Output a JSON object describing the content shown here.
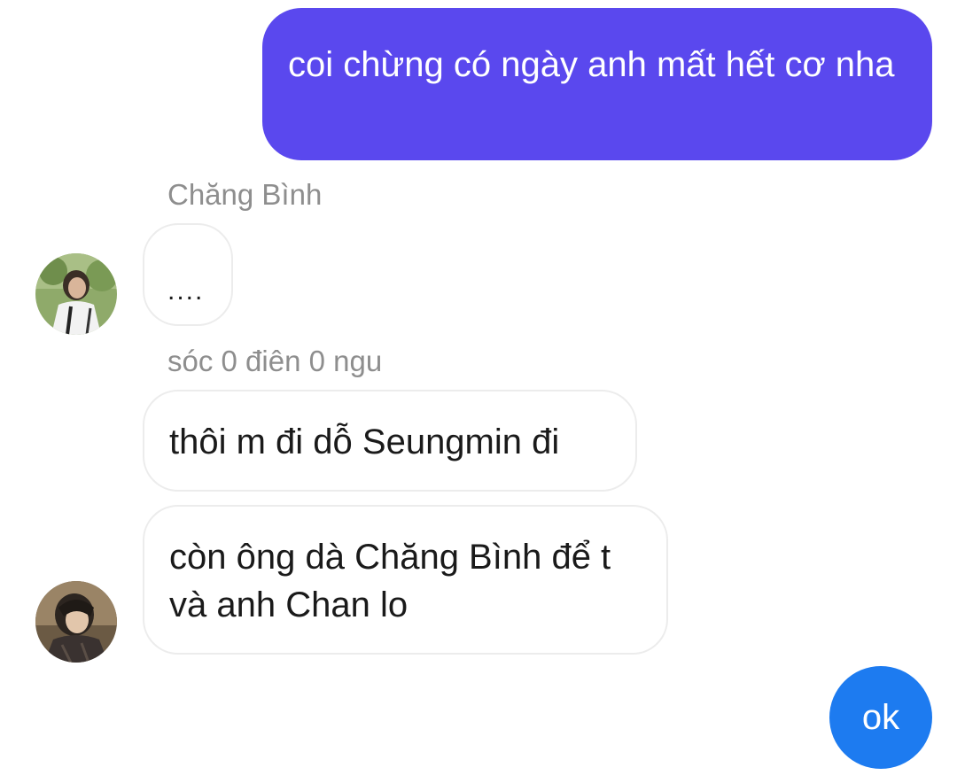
{
  "colors": {
    "outgoing_primary": "#5a48ee",
    "outgoing_ok": "#1d7bf0",
    "incoming_border": "#ececec",
    "sender_name": "#8e8e8e"
  },
  "messages": [
    {
      "direction": "outgoing",
      "text": "coi chừng có ngày anh mất hết cơ nha"
    },
    {
      "direction": "incoming",
      "sender": "Chăng Bình",
      "text": "...."
    },
    {
      "direction": "incoming",
      "sender": "sóc 0 điên 0 ngu",
      "text": "thôi m đi dỗ Seungmin đi"
    },
    {
      "direction": "incoming",
      "text": "còn ông dà Chăng Bình để t và anh Chan lo"
    },
    {
      "direction": "outgoing",
      "text": "ok"
    }
  ]
}
